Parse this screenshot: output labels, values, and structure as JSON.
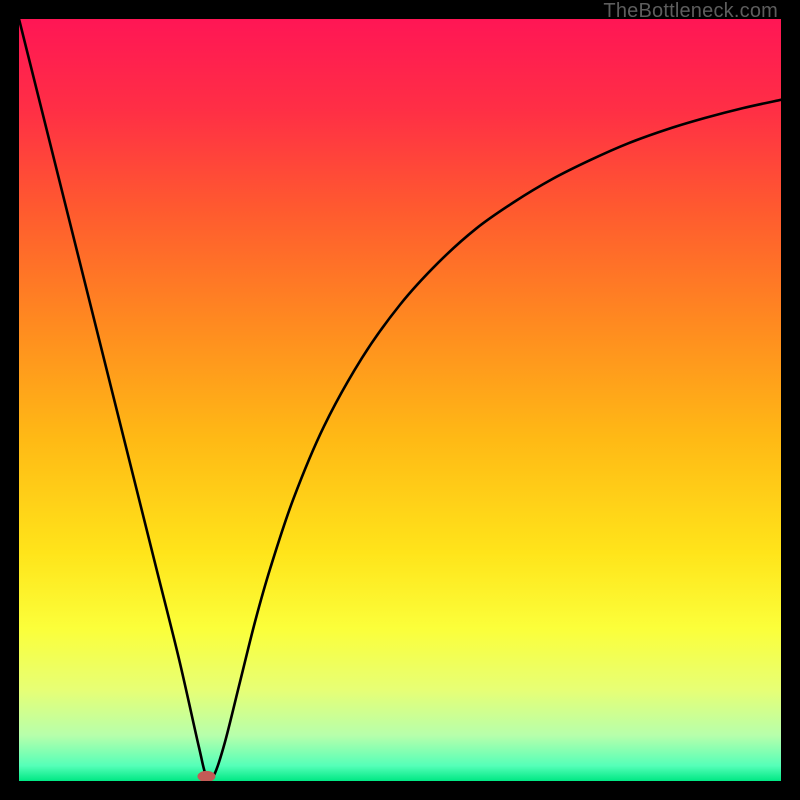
{
  "watermark": "TheBottleneck.com",
  "chart_data": {
    "type": "line",
    "title": "",
    "xlabel": "",
    "ylabel": "",
    "xlim": [
      0,
      100
    ],
    "ylim": [
      0,
      100
    ],
    "grid": false,
    "legend": false,
    "gradient_bands": [
      {
        "position": 0.0,
        "color": "#ff1655"
      },
      {
        "position": 0.12,
        "color": "#ff2f45"
      },
      {
        "position": 0.25,
        "color": "#ff5a2f"
      },
      {
        "position": 0.4,
        "color": "#ff8a20"
      },
      {
        "position": 0.55,
        "color": "#ffb915"
      },
      {
        "position": 0.7,
        "color": "#ffe41a"
      },
      {
        "position": 0.8,
        "color": "#fbff3a"
      },
      {
        "position": 0.88,
        "color": "#e7ff75"
      },
      {
        "position": 0.94,
        "color": "#b7ffab"
      },
      {
        "position": 0.98,
        "color": "#55ffb8"
      },
      {
        "position": 1.0,
        "color": "#00e884"
      }
    ],
    "series": [
      {
        "name": "bottleneck-curve",
        "x": [
          0,
          3,
          6,
          9,
          12,
          15,
          18,
          21,
          23.6,
          24.6,
          25.6,
          27,
          29,
          31,
          33,
          36,
          40,
          45,
          50,
          55,
          60,
          65,
          70,
          75,
          80,
          85,
          90,
          95,
          100
        ],
        "y": [
          100,
          88,
          76,
          64,
          52,
          40,
          28,
          16,
          4.5,
          0.6,
          0.8,
          5,
          13,
          21,
          28,
          37,
          46.5,
          55.5,
          62.5,
          68,
          72.5,
          76,
          79,
          81.5,
          83.7,
          85.5,
          87,
          88.3,
          89.4
        ]
      }
    ],
    "marker": {
      "name": "minimum-marker",
      "x": 24.6,
      "y": 0.6,
      "color": "#c45a56"
    }
  }
}
